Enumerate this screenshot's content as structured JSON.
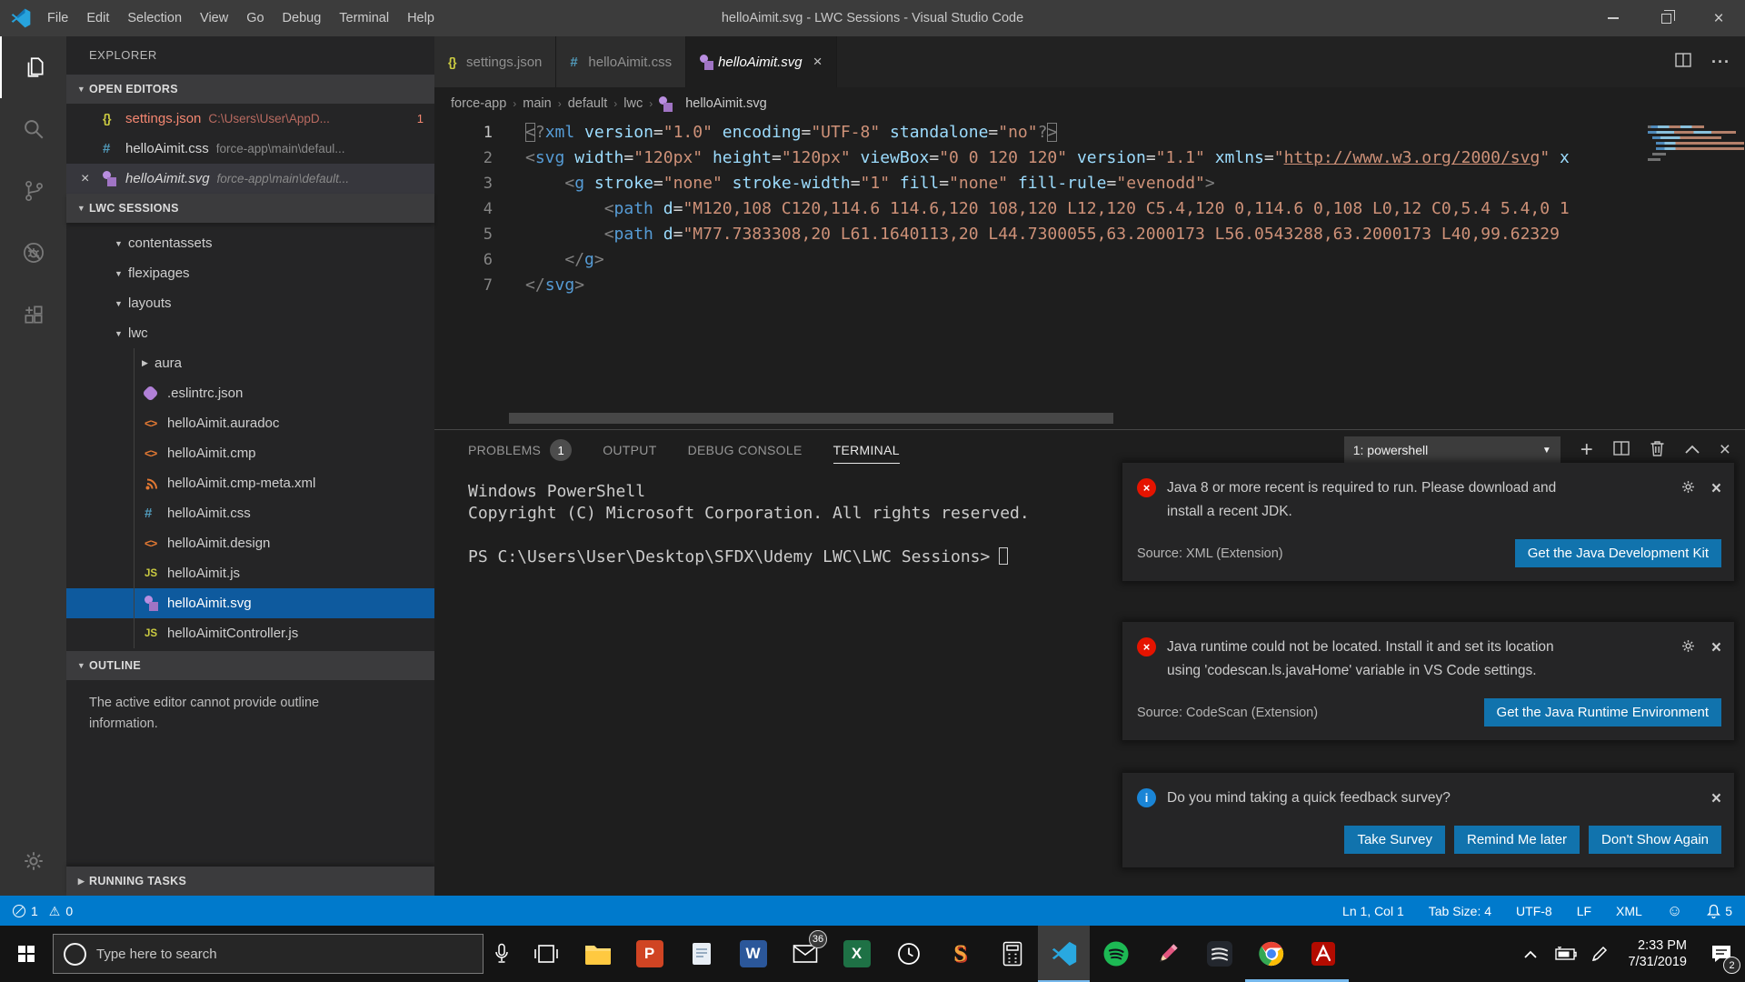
{
  "window": {
    "title": "helloAimit.svg - LWC Sessions - Visual Studio Code",
    "menus": [
      "File",
      "Edit",
      "Selection",
      "View",
      "Go",
      "Debug",
      "Terminal",
      "Help"
    ]
  },
  "activity_bar": {
    "items": [
      "explorer",
      "search",
      "source-control",
      "debug",
      "extensions"
    ],
    "bottom": [
      "manage"
    ]
  },
  "sidebar": {
    "title": "EXPLORER",
    "open_editors": {
      "header": "OPEN EDITORS",
      "items": [
        {
          "icon": "json",
          "name": "settings.json",
          "path": "C:\\Users\\User\\AppD...",
          "badge": "1",
          "error": true
        },
        {
          "icon": "css",
          "name": "helloAimit.css",
          "path": "force-app\\main\\defaul..."
        },
        {
          "icon": "svg",
          "name": "helloAimit.svg",
          "path": "force-app\\main\\default...",
          "active": true,
          "preview": true,
          "close": true
        }
      ]
    },
    "project": {
      "header": "LWC SESSIONS",
      "items": [
        {
          "label": "contentassets",
          "type": "folder",
          "expanded": true,
          "depth": 0
        },
        {
          "label": "flexipages",
          "type": "folder",
          "expanded": true,
          "depth": 0
        },
        {
          "label": "layouts",
          "type": "folder",
          "expanded": true,
          "depth": 0
        },
        {
          "label": "lwc",
          "type": "folder",
          "expanded": true,
          "depth": 0
        },
        {
          "label": "aura",
          "type": "folder",
          "expanded": false,
          "depth": 1
        },
        {
          "label": ".eslintrc.json",
          "icon": "eslint",
          "depth": 1
        },
        {
          "label": "helloAimit.auradoc",
          "icon": "code",
          "depth": 1
        },
        {
          "label": "helloAimit.cmp",
          "icon": "code",
          "depth": 1
        },
        {
          "label": "helloAimit.cmp-meta.xml",
          "icon": "xml",
          "depth": 1
        },
        {
          "label": "helloAimit.css",
          "icon": "css",
          "depth": 1
        },
        {
          "label": "helloAimit.design",
          "icon": "code",
          "depth": 1
        },
        {
          "label": "helloAimit.js",
          "icon": "js",
          "depth": 1
        },
        {
          "label": "helloAimit.svg",
          "icon": "svg",
          "depth": 1,
          "selected": true
        },
        {
          "label": "helloAimitController.js",
          "icon": "js",
          "depth": 1
        }
      ]
    },
    "outline": {
      "header": "OUTLINE",
      "message": "The active editor cannot provide outline information."
    },
    "running_tasks": {
      "header": "RUNNING TASKS"
    }
  },
  "editor": {
    "tabs": [
      {
        "icon": "json",
        "label": "settings.json"
      },
      {
        "icon": "css",
        "label": "helloAimit.css"
      },
      {
        "icon": "svg",
        "label": "helloAimit.svg",
        "active": true,
        "preview": true,
        "close": "×"
      }
    ],
    "breadcrumb": {
      "folders": [
        "force-app",
        "main",
        "default",
        "lwc"
      ],
      "file": "helloAimit.svg"
    },
    "code_lines": [
      {
        "num": "1",
        "current": true,
        "tokens": [
          [
            "pb",
            "<"
          ],
          [
            "p",
            "?"
          ],
          [
            "tag",
            "xml"
          ],
          [
            "t",
            " "
          ],
          [
            "attr",
            "version"
          ],
          [
            "eq",
            "="
          ],
          [
            "str",
            "\"1.0\""
          ],
          [
            "t",
            " "
          ],
          [
            "attr",
            "encoding"
          ],
          [
            "eq",
            "="
          ],
          [
            "str",
            "\"UTF-8\""
          ],
          [
            "t",
            " "
          ],
          [
            "attr",
            "standalone"
          ],
          [
            "eq",
            "="
          ],
          [
            "str",
            "\"no\""
          ],
          [
            "p",
            "?"
          ],
          [
            "pb",
            ">"
          ]
        ]
      },
      {
        "num": "2",
        "tokens": [
          [
            "p",
            "<"
          ],
          [
            "tag",
            "svg"
          ],
          [
            "t",
            " "
          ],
          [
            "attr",
            "width"
          ],
          [
            "eq",
            "="
          ],
          [
            "str",
            "\"120px\""
          ],
          [
            "t",
            " "
          ],
          [
            "attr",
            "height"
          ],
          [
            "eq",
            "="
          ],
          [
            "str",
            "\"120px\""
          ],
          [
            "t",
            " "
          ],
          [
            "attr",
            "viewBox"
          ],
          [
            "eq",
            "="
          ],
          [
            "str",
            "\"0 0 120 120\""
          ],
          [
            "t",
            " "
          ],
          [
            "attr",
            "version"
          ],
          [
            "eq",
            "="
          ],
          [
            "str",
            "\"1.1\""
          ],
          [
            "t",
            " "
          ],
          [
            "attr",
            "xmlns"
          ],
          [
            "eq",
            "="
          ],
          [
            "str",
            "\""
          ],
          [
            "link",
            "http://www.w3.org/2000/svg"
          ],
          [
            "str",
            "\""
          ],
          [
            "t",
            " "
          ],
          [
            "attr",
            "x"
          ]
        ]
      },
      {
        "num": "3",
        "tokens": [
          [
            "t",
            "    "
          ],
          [
            "p",
            "<"
          ],
          [
            "tag",
            "g"
          ],
          [
            "t",
            " "
          ],
          [
            "attr",
            "stroke"
          ],
          [
            "eq",
            "="
          ],
          [
            "str",
            "\"none\""
          ],
          [
            "t",
            " "
          ],
          [
            "attr",
            "stroke-width"
          ],
          [
            "eq",
            "="
          ],
          [
            "str",
            "\"1\""
          ],
          [
            "t",
            " "
          ],
          [
            "attr",
            "fill"
          ],
          [
            "eq",
            "="
          ],
          [
            "str",
            "\"none\""
          ],
          [
            "t",
            " "
          ],
          [
            "attr",
            "fill-rule"
          ],
          [
            "eq",
            "="
          ],
          [
            "str",
            "\"evenodd\""
          ],
          [
            "p",
            ">"
          ]
        ]
      },
      {
        "num": "4",
        "tokens": [
          [
            "t",
            "        "
          ],
          [
            "p",
            "<"
          ],
          [
            "tag",
            "path"
          ],
          [
            "t",
            " "
          ],
          [
            "attr",
            "d"
          ],
          [
            "eq",
            "="
          ],
          [
            "str",
            "\"M120,108 C120,114.6 114.6,120 108,120 L12,120 C5.4,120 0,114.6 0,108 L0,12 C0,5.4 5.4,0 1"
          ]
        ]
      },
      {
        "num": "5",
        "tokens": [
          [
            "t",
            "        "
          ],
          [
            "p",
            "<"
          ],
          [
            "tag",
            "path"
          ],
          [
            "t",
            " "
          ],
          [
            "attr",
            "d"
          ],
          [
            "eq",
            "="
          ],
          [
            "str",
            "\"M77.7383308,20 L61.1640113,20 L44.7300055,63.2000173 L56.0543288,63.2000173 L40,99.62329"
          ]
        ]
      },
      {
        "num": "6",
        "tokens": [
          [
            "t",
            "    "
          ],
          [
            "p",
            "</"
          ],
          [
            "tag",
            "g"
          ],
          [
            "p",
            ">"
          ]
        ]
      },
      {
        "num": "7",
        "tokens": [
          [
            "p",
            "</"
          ],
          [
            "tag",
            "svg"
          ],
          [
            "p",
            ">"
          ]
        ]
      }
    ]
  },
  "panel": {
    "tabs": [
      {
        "label": "PROBLEMS",
        "badge": "1"
      },
      {
        "label": "OUTPUT"
      },
      {
        "label": "DEBUG CONSOLE"
      },
      {
        "label": "TERMINAL",
        "active": true
      }
    ],
    "terminal_select": "1: powershell",
    "terminal_lines": [
      {
        "text": "Windows PowerShell"
      },
      {
        "text": "Copyright (C) Microsoft Corporation. All rights reserved."
      },
      {
        "text": ""
      },
      {
        "text": "PS C:\\Users\\User\\Desktop\\SFDX\\Udemy LWC\\LWC Sessions>",
        "cursor": true
      }
    ]
  },
  "notifications": [
    {
      "severity": "error",
      "message_lines": [
        "Java 8 or more recent is required to run. Please download and",
        "install a recent JDK."
      ],
      "source": "Source: XML (Extension)",
      "gear": true,
      "buttons": [
        "Get the Java Development Kit"
      ]
    },
    {
      "severity": "error",
      "message_lines": [
        "Java runtime could not be located. Install it and set its location",
        "using 'codescan.ls.javaHome' variable in VS Code settings."
      ],
      "source": "Source: CodeScan (Extension)",
      "gear": true,
      "buttons": [
        "Get the Java Runtime Environment"
      ]
    },
    {
      "severity": "info",
      "message_lines": [
        "Do you mind taking a quick feedback survey?"
      ],
      "buttons": [
        "Take Survey",
        "Remind Me later",
        "Don't Show Again"
      ]
    }
  ],
  "status_bar": {
    "errors": "1",
    "warnings": "0",
    "items_right": [
      "Ln 1, Col 1",
      "Tab Size: 4",
      "UTF-8",
      "LF",
      "XML"
    ],
    "bell_count": "5"
  },
  "taskbar": {
    "search_placeholder": "Type here to search",
    "apps": [
      "task-view",
      "file-explorer",
      "powerpoint",
      "notepad",
      "word",
      "mail",
      "excel",
      "clock-app",
      "s-app",
      "calculator",
      "vscode",
      "spotify",
      "pencil-app",
      "music-app",
      "chrome",
      "acrobat"
    ],
    "mail_badge": "36",
    "clock_time": "2:33 PM",
    "clock_date": "7/31/2019",
    "notification_count": "2"
  },
  "colors": {
    "status_bar": "#007acc",
    "button": "#1173ad",
    "selection": "#0e5a9e",
    "error": "#e51400",
    "info": "#1a85d6",
    "modified_file": "#f48771"
  }
}
